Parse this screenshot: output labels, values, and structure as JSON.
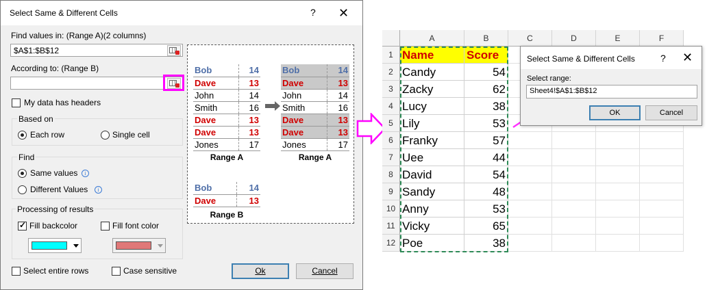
{
  "dialog": {
    "title": "Select Same & Different Cells",
    "help": "?",
    "close": "✕",
    "find_values_label": "Find values in: (Range A)(2 columns)",
    "find_values_value": "$A$1:$B$12",
    "according_label": "According to: (Range B)",
    "according_value": "",
    "headers_label": "My data has headers",
    "based_on": {
      "legend": "Based on",
      "each_row": "Each row",
      "single_cell": "Single cell"
    },
    "find": {
      "legend": "Find",
      "same": "Same values",
      "different": "Different Values"
    },
    "processing": {
      "legend": "Processing of results",
      "fill_back": "Fill backcolor",
      "fill_font": "Fill font color"
    },
    "select_rows": "Select entire rows",
    "case_sensitive": "Case sensitive",
    "ok": "Ok",
    "cancel": "Cancel",
    "colors": {
      "backcolor": "#00ffff",
      "fontcolor": "#e07878"
    }
  },
  "preview": {
    "rangeA": [
      {
        "name": "Bob",
        "val": "14"
      },
      {
        "name": "Dave",
        "val": "13"
      },
      {
        "name": "John",
        "val": "14"
      },
      {
        "name": "Smith",
        "val": "16"
      },
      {
        "name": "Dave",
        "val": "13"
      },
      {
        "name": "Dave",
        "val": "13"
      },
      {
        "name": "Jones",
        "val": "17"
      }
    ],
    "rangeB": [
      {
        "name": "Bob",
        "val": "14"
      },
      {
        "name": "Dave",
        "val": "13"
      }
    ],
    "label_a": "Range A",
    "label_b": "Range B"
  },
  "sheet": {
    "columns": [
      "A",
      "B",
      "C",
      "D",
      "E",
      "F"
    ],
    "rows": [
      "1",
      "2",
      "3",
      "4",
      "5",
      "6",
      "7",
      "8",
      "9",
      "10",
      "11",
      "12"
    ],
    "header": {
      "name": "Name",
      "score": "Score"
    },
    "data": [
      {
        "name": "Candy",
        "score": "54"
      },
      {
        "name": "Zacky",
        "score": "62"
      },
      {
        "name": "Lucy",
        "score": "38"
      },
      {
        "name": "Lily",
        "score": "53"
      },
      {
        "name": "Franky",
        "score": "57"
      },
      {
        "name": "Uee",
        "score": "44"
      },
      {
        "name": "David",
        "score": "54"
      },
      {
        "name": "Sandy",
        "score": "48"
      },
      {
        "name": "Anny",
        "score": "53"
      },
      {
        "name": "Vicky",
        "score": "65"
      },
      {
        "name": "Poe",
        "score": "38"
      }
    ]
  },
  "small_dialog": {
    "title": "Select Same & Different Cells",
    "help": "?",
    "close": "✕",
    "range_label": "Select range:",
    "range_value": "Sheet4!$A$1:$B$12",
    "ok": "OK",
    "cancel": "Cancel"
  }
}
